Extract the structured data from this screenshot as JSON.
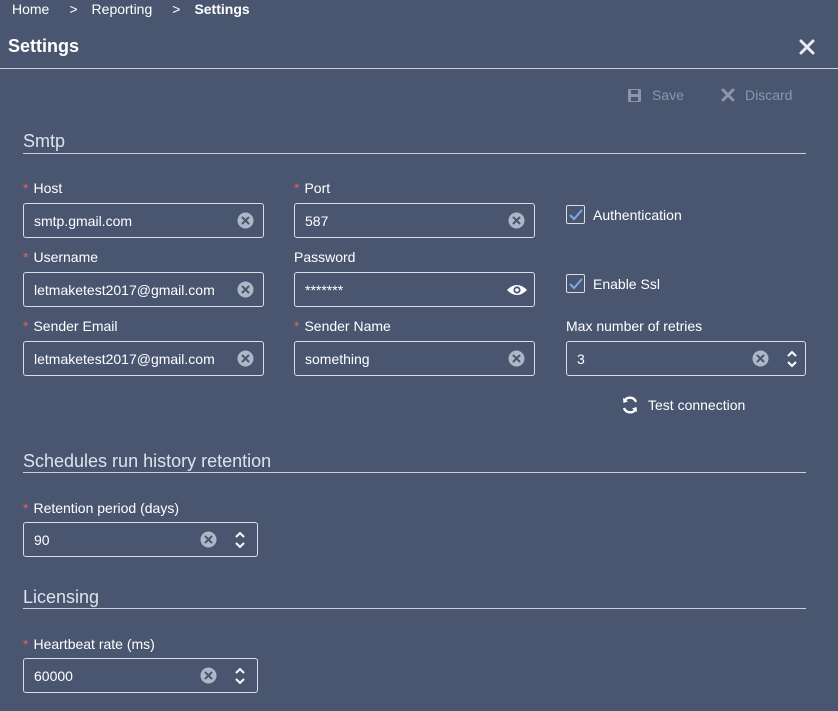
{
  "breadcrumb": {
    "items": [
      "Home",
      "Reporting"
    ],
    "separator": ">",
    "current": "Settings"
  },
  "dialog": {
    "title": "Settings",
    "close_icon": "close-icon"
  },
  "toolbar": {
    "save_label": "Save",
    "discard_label": "Discard"
  },
  "smtp": {
    "section_title": "Smtp",
    "host": {
      "label": "Host",
      "required": "*",
      "value": "smtp.gmail.com"
    },
    "port": {
      "label": "Port",
      "required": "*",
      "value": "587"
    },
    "authentication": {
      "label": "Authentication",
      "checked": true
    },
    "username": {
      "label": "Username",
      "required": "*",
      "value": "letmaketest2017@gmail.com"
    },
    "password": {
      "label": "Password",
      "value": "*******"
    },
    "enable_ssl": {
      "label": "Enable Ssl",
      "checked": true
    },
    "sender_email": {
      "label": "Sender Email",
      "required": "*",
      "value": "letmaketest2017@gmail.com"
    },
    "sender_name": {
      "label": "Sender Name",
      "required": "*",
      "value": "something"
    },
    "max_retries": {
      "label": "Max number of retries",
      "value": "3"
    },
    "test_connection_label": "Test connection"
  },
  "schedules": {
    "section_title": "Schedules run history retention",
    "retention": {
      "label": "Retention period (days)",
      "required": "*",
      "value": "90"
    }
  },
  "licensing": {
    "section_title": "Licensing",
    "heartbeat": {
      "label": "Heartbeat rate (ms)",
      "required": "*",
      "value": "60000"
    }
  },
  "colors": {
    "background": "#4a5670",
    "required": "#e06060",
    "disabled": "#8b96ad",
    "border": "#d8dde6"
  }
}
